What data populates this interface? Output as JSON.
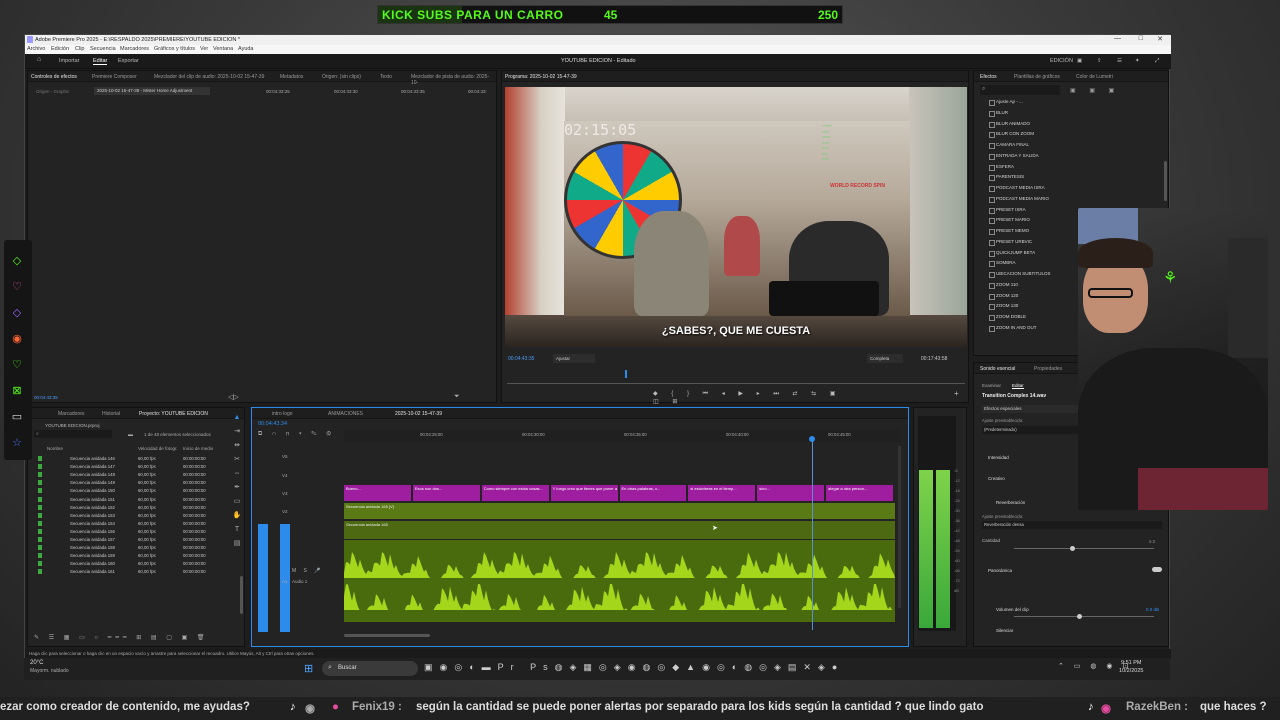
{
  "stream": {
    "banner_text": "KICK SUBS PARA UN CARRO",
    "banner_current": "45",
    "banner_goal": "250",
    "banner_progress": 0.18,
    "ticker": [
      "ezar como creador de contenido, me ayudas?",
      "Fenix19 :",
      "según la cantidad  se puede poner alertas por separado para los kids según la cantidad ?  que lindo gato",
      "RazekBen :",
      "que haces ?"
    ]
  },
  "window": {
    "title": "Adobe Premiere Pro 2025 - E:\\RESPALDO 2025\\PREMIERE\\YOUTUBE EDICION *",
    "menu": [
      "Archivo",
      "Edición",
      "Clip",
      "Secuencia",
      "Marcadores",
      "Gráficos y títulos",
      "Ver",
      "Ventana",
      "Ayuda"
    ],
    "header_tabs": [
      "Importar",
      "Editar",
      "Exportar"
    ],
    "project_title": "YOUTUBE EDICION - Editado",
    "workspace": "EDICIÓN",
    "controls": [
      "—",
      "□",
      "✕"
    ]
  },
  "source_panel": {
    "tabs": [
      "Controles de efectos",
      "Premiere Composer",
      "Mezclador del clip de audio: 2025-10-02 15-47-39",
      "Metadatos",
      "Origen: (sin clips)",
      "Texto",
      "Mezclador de pista de audio: 2025-10-"
    ],
    "source_label": "Origen - Graphic",
    "clip_label": "2025-10-02 15-47-39 - Mister Home Adjustment",
    "times": [
      "00:04:33:25",
      "00:04:33:30",
      "00:04:33:35",
      "00:04:33:"
    ],
    "bottom_tc": "00:04:43:35"
  },
  "program": {
    "tab_label": "Programa: 2025-10-02 15-47-39",
    "overlay_timecode": "02:15:05",
    "subtitle": "¿SABES?, QUE ME CUESTA",
    "overlay_wr": "WORLD RECORD SPIN",
    "current_tc": "00:04:43:35",
    "fit": "Ajustar",
    "quality": "Completa",
    "duration_tc": "00:17:43:58"
  },
  "project": {
    "tabs": [
      "Marcadores",
      "Historial",
      "Proyecto: YOUTUBE EDICION"
    ],
    "file": "YOUTUBE EDICION.prproj",
    "count": "1 de 48 elementos seleccionados",
    "columns": [
      "Nombre",
      "Velocidad de fotogr.",
      "Inicio de medio"
    ],
    "rows": [
      {
        "name": "Secuencia anidada 146",
        "fps": "60,00 fps",
        "tc": "00:00:00:00"
      },
      {
        "name": "Secuencia anidada 147",
        "fps": "60,00 fps",
        "tc": "00:00:00:00"
      },
      {
        "name": "Secuencia anidada 148",
        "fps": "60,00 fps",
        "tc": "00:00:00:00"
      },
      {
        "name": "Secuencia anidada 149",
        "fps": "60,00 fps",
        "tc": "00:00:00:00"
      },
      {
        "name": "Secuencia anidada 150",
        "fps": "60,00 fps",
        "tc": "00:00:00:00"
      },
      {
        "name": "Secuencia anidada 151",
        "fps": "60,00 fps",
        "tc": "00:00:00:00"
      },
      {
        "name": "Secuencia anidada 152",
        "fps": "60,00 fps",
        "tc": "00:00:00:00"
      },
      {
        "name": "Secuencia anidada 153",
        "fps": "60,00 fps",
        "tc": "00:00:00:00"
      },
      {
        "name": "Secuencia anidada 154",
        "fps": "60,00 fps",
        "tc": "00:00:00:00"
      },
      {
        "name": "Secuencia anidada 156",
        "fps": "60,00 fps",
        "tc": "00:00:00:00"
      },
      {
        "name": "Secuencia anidada 157",
        "fps": "60,00 fps",
        "tc": "00:00:00:00"
      },
      {
        "name": "Secuencia anidada 158",
        "fps": "60,00 fps",
        "tc": "00:00:00:00"
      },
      {
        "name": "Secuencia anidada 159",
        "fps": "60,00 fps",
        "tc": "00:00:00:00"
      },
      {
        "name": "Secuencia anidada 160",
        "fps": "60,00 fps",
        "tc": "00:00:00:00"
      },
      {
        "name": "Secuencia anidada 161",
        "fps": "60,00 fps",
        "tc": "00:00:00:00"
      }
    ]
  },
  "timeline": {
    "tabs": [
      "intro logo",
      "ANIMACIONES",
      "2025-10-02 15-47-39"
    ],
    "current_tc": "00:04:43:34",
    "ruler": [
      "00:04:25:00",
      "00:04:30:00",
      "00:04:35:00",
      "00:04:40:00",
      "00:04:45:00"
    ],
    "tracks": [
      "V5",
      "V4",
      "V3",
      "V2",
      "V1",
      "A1"
    ],
    "audio_track_name": "Audio 1",
    "v3_clips": [
      "Bueno...",
      "Esos son dos...",
      "Como siempre con estos cosas...",
      "Y luego creo que tienes que poner a Pele al...",
      "En otras palabras, c...",
      "si estuvieras en el tiemp...",
      "sino...",
      "alegar a otra person..."
    ],
    "v2_clip": "Secuencia anidada 165 [V]",
    "v1_clip": "Secuencia anidada 165"
  },
  "effects": {
    "tabs": [
      "Efectos",
      "Plantillas de gráficos",
      "Color de Lumetri"
    ],
    "items": [
      "Ajuste Ap - ...",
      "BLUR",
      "BLUR ANIMADO",
      "BLUR CON ZOOM",
      "CAMARA FINAL",
      "ENTRADA Y SALIDA",
      "ESFERA",
      "PARENTESIS",
      "PODCAST MEDIA ISRA",
      "PODCAST MEDIA MARIO",
      "PRESET ISRA",
      "PRESET MARIO",
      "PRESET MEMO",
      "PRESET URBVIC",
      "QUICKJUMP BETA",
      "SOMBRA",
      "UBICACION SUBTITULOS",
      "ZOOM 110",
      "ZOOM 120",
      "ZOOM 130",
      "ZOOM DOBLE",
      "ZOOM IN AND OUT"
    ]
  },
  "essential_sound": {
    "tabs": [
      "Sonido esencial",
      "Propiedades"
    ],
    "subtabs": [
      "Examinar",
      "Editar"
    ],
    "clip": "Transition Complex 14.wav",
    "section": "Efectos especiales",
    "preset_label": "Ajuste preestablecido:",
    "preset_value": "(Predeterminado)",
    "groups": [
      "Intensidad",
      "Creativo",
      "Reverberación",
      "Ajuste preestablecido:",
      "Reverberación densa",
      "Cantidad",
      "Panorámica",
      "Volumen del clip",
      "Silenciar"
    ],
    "cantidad_val": "5.0",
    "volume_val": "0.0 dB"
  },
  "status_bar": "Haga clic para seleccionar o haga clic en un espacio vacío y arrastre para seleccionar el recuadro. Utilice Mayús, Alt y Ctrl para otras opciones.",
  "taskbar": {
    "weather_temp": "20°C",
    "weather_desc": "Mayorm. nublado",
    "search": "Buscar",
    "time": "9:51 PM",
    "date": "10/2/2025"
  },
  "colors": {
    "accent_green": "#53fc18",
    "v3_purple": "#9f1ea0",
    "audio_green": "#7fb518",
    "premiere_blue": "#2d8ceb"
  }
}
